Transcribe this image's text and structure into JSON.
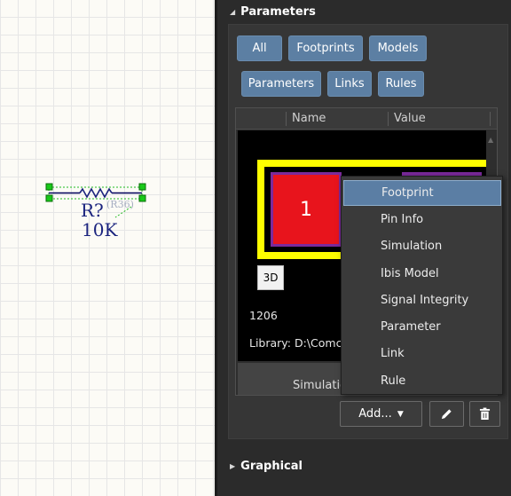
{
  "canvas": {
    "component": {
      "designator": "R?",
      "designator_note": "(R36)",
      "value": "10K"
    }
  },
  "panel": {
    "parameters_title": "Parameters",
    "graphical_title": "Graphical",
    "filters": {
      "all": "All",
      "footprints": "Footprints",
      "models": "Models",
      "parameters": "Parameters",
      "links": "Links",
      "rules": "Rules"
    },
    "grid": {
      "col_name": "Name",
      "col_value": "Value"
    },
    "preview": {
      "pad_label": "1",
      "btn_3d": "3D",
      "footprint_name": "1206",
      "library": "Library: D:\\Comc"
    },
    "row_text": "Simulatio",
    "add_label": "Add...",
    "add_arrow": "▼"
  },
  "context_menu": {
    "items": [
      "Footprint",
      "Pin Info",
      "Simulation",
      "Ibis Model",
      "Signal Integrity",
      "Parameter",
      "Link",
      "Rule"
    ]
  },
  "colors": {
    "canvas_bg": "#fcfbf6",
    "panel_bg": "#2b2b2b",
    "accent_button": "#5c7fa3",
    "menu_selected": "#5b7ea4",
    "pad_red": "#e8141c",
    "pad_outline_yellow": "#ffff00",
    "component_text": "#1a237e"
  }
}
